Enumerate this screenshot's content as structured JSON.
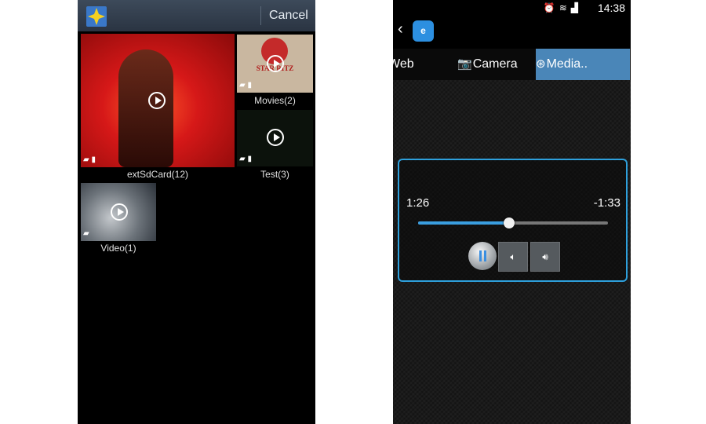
{
  "gallery": {
    "cancel_label": "Cancel",
    "albums": [
      {
        "label": "extSdCard(12)"
      },
      {
        "label": "Movies(2)"
      },
      {
        "label": "Test(3)"
      },
      {
        "label": "Video(1)"
      }
    ],
    "movies_thumb_text": "STAR RITZ"
  },
  "media_app": {
    "status": {
      "clock": "14:38"
    },
    "tabs": [
      {
        "label": "Web",
        "icon": "globe-icon"
      },
      {
        "label": "Camera",
        "icon": "camera-icon"
      },
      {
        "label": "Media..",
        "icon": "film-reel-icon",
        "active": true
      }
    ],
    "player": {
      "elapsed": "1:26",
      "remaining": "-1:33",
      "progress": 0.48
    },
    "accent_color": "#2ea0dc"
  }
}
